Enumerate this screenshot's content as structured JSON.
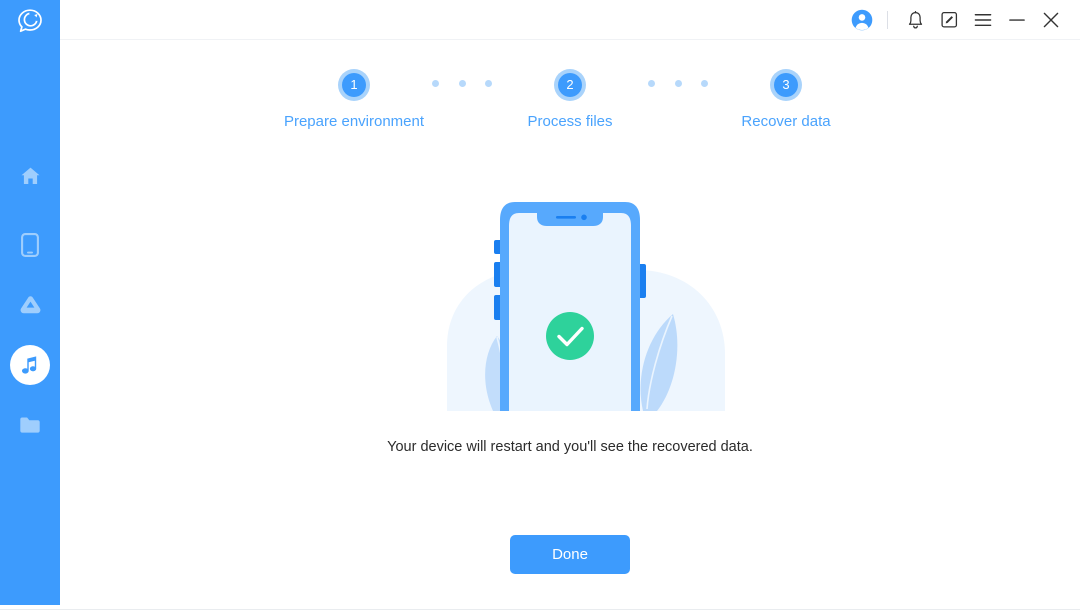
{
  "app": {
    "logo_icon": "chat-bubble-c-logo",
    "accent_color": "#3d9bfd",
    "sidebar_color": "#3d9bfd",
    "success_color": "#2ed29b",
    "step_text_color": "#4aa3fd"
  },
  "sidebar": {
    "items": [
      {
        "name": "home",
        "icon": "home-icon",
        "active": false
      },
      {
        "name": "device",
        "icon": "phone-icon",
        "active": false
      },
      {
        "name": "cloud",
        "icon": "cloud-icon",
        "active": false
      },
      {
        "name": "music",
        "icon": "music-note-icon",
        "active": true
      },
      {
        "name": "files",
        "icon": "folder-icon",
        "active": false
      }
    ]
  },
  "titlebar": {
    "buttons": [
      {
        "name": "account",
        "icon": "user-avatar-icon"
      },
      {
        "name": "notifications",
        "icon": "bell-icon"
      },
      {
        "name": "feedback",
        "icon": "note-edit-icon"
      },
      {
        "name": "menu",
        "icon": "hamburger-menu-icon"
      },
      {
        "name": "minimize",
        "icon": "minimize-icon"
      },
      {
        "name": "close",
        "icon": "close-icon"
      }
    ]
  },
  "stepper": {
    "steps": [
      {
        "number": "1",
        "label": "Prepare environment"
      },
      {
        "number": "2",
        "label": "Process files"
      },
      {
        "number": "3",
        "label": "Recover data"
      }
    ]
  },
  "illustration": {
    "name": "phone-success-illustration",
    "status_icon": "green-check-circle"
  },
  "main": {
    "hint": "Your device will restart and you'll see the recovered data.",
    "done_label": "Done"
  }
}
